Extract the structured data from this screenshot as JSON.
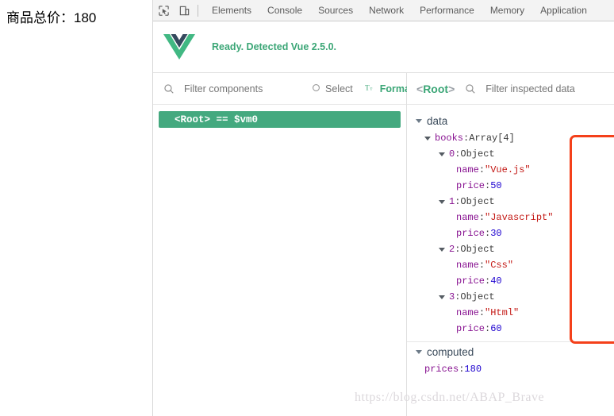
{
  "page": {
    "total_label": "商品总价：180"
  },
  "devtools": {
    "icons": {
      "inspect": "inspect-cursor-icon",
      "device": "device-toolbar-icon"
    },
    "tabs": [
      {
        "label": "Elements"
      },
      {
        "label": "Console"
      },
      {
        "label": "Sources"
      },
      {
        "label": "Network"
      },
      {
        "label": "Performance"
      },
      {
        "label": "Memory"
      },
      {
        "label": "Application"
      }
    ]
  },
  "vue_banner": {
    "message": "Ready. Detected Vue 2.5.0.",
    "logo_green": "#41B883",
    "logo_navy": "#35495E",
    "text_color": "#3ba676"
  },
  "components_pane": {
    "filter_placeholder": "Filter components",
    "select_label": "Select",
    "format_label": "Format",
    "tree": [
      {
        "label": "<Root> == $vm0",
        "selected": true
      }
    ],
    "selected_bg": "#44a97f"
  },
  "inspector_pane": {
    "root_tag_open": "<",
    "root_tag_name": "Root",
    "root_tag_close": ">",
    "filter_placeholder": "Filter inspected data",
    "sections": [
      {
        "name": "data",
        "rows": [
          {
            "indent": 1,
            "caret": true,
            "key": "books",
            "sep": ": ",
            "value": "Array[4]",
            "vtype": "plain"
          },
          {
            "indent": 2,
            "caret": true,
            "key": "0",
            "sep": ": ",
            "value": "Object",
            "vtype": "plain",
            "ktype": "idx"
          },
          {
            "indent": 3,
            "caret": false,
            "key": "name",
            "sep": ": ",
            "value": "\"Vue.js\"",
            "vtype": "str"
          },
          {
            "indent": 3,
            "caret": false,
            "key": "price",
            "sep": ": ",
            "value": "50",
            "vtype": "num"
          },
          {
            "indent": 2,
            "caret": true,
            "key": "1",
            "sep": ": ",
            "value": "Object",
            "vtype": "plain",
            "ktype": "idx"
          },
          {
            "indent": 3,
            "caret": false,
            "key": "name",
            "sep": ": ",
            "value": "\"Javascript\"",
            "vtype": "str"
          },
          {
            "indent": 3,
            "caret": false,
            "key": "price",
            "sep": ": ",
            "value": "30",
            "vtype": "num"
          },
          {
            "indent": 2,
            "caret": true,
            "key": "2",
            "sep": ": ",
            "value": "Object",
            "vtype": "plain",
            "ktype": "idx"
          },
          {
            "indent": 3,
            "caret": false,
            "key": "name",
            "sep": ": ",
            "value": "\"Css\"",
            "vtype": "str"
          },
          {
            "indent": 3,
            "caret": false,
            "key": "price",
            "sep": ": ",
            "value": "40",
            "vtype": "num"
          },
          {
            "indent": 2,
            "caret": true,
            "key": "3",
            "sep": ": ",
            "value": "Object",
            "vtype": "plain",
            "ktype": "idx"
          },
          {
            "indent": 3,
            "caret": false,
            "key": "name",
            "sep": ": ",
            "value": "\"Html\"",
            "vtype": "str"
          },
          {
            "indent": 3,
            "caret": false,
            "key": "price",
            "sep": ": ",
            "value": "60",
            "vtype": "num"
          }
        ]
      },
      {
        "name": "computed",
        "rows": [
          {
            "indent": 1,
            "caret": false,
            "key": "prices",
            "sep": ": ",
            "value": "180",
            "vtype": "num"
          }
        ]
      }
    ]
  },
  "annotations": {
    "color": "#f4401a",
    "box_target": "books-array-highlight",
    "arrow_target": "computed-prices-arrow"
  },
  "watermark": {
    "text": "https://blog.csdn.net/ABAP_Brave"
  }
}
